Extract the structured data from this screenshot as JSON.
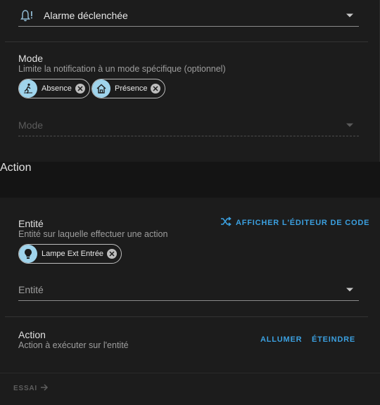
{
  "trigger": {
    "selected_value": "Alarme déclenchée"
  },
  "mode_section": {
    "label": "Mode",
    "description": "Limite la notification à un mode spécifique (optionnel)",
    "chips": [
      {
        "label": "Absence",
        "icon": "walking-person-icon"
      },
      {
        "label": "Présence",
        "icon": "home-icon"
      }
    ],
    "placeholder": "Mode"
  },
  "action_header": {
    "title": "Action"
  },
  "entity_section": {
    "label": "Entité",
    "description": "Entité sur laquelle effectuer une action",
    "code_editor_button": "AFFICHER L'ÉDITEUR DE CODE",
    "chips": [
      {
        "label": "Lampe Ext Entrée",
        "icon": "lightbulb-icon"
      }
    ],
    "placeholder": "Entité"
  },
  "action_section": {
    "label": "Action",
    "description": "Action à exécuter sur l'entité",
    "on_button": "ALLUMER",
    "off_button": "ÉTEINDRE"
  },
  "footer": {
    "test_button": "ESSAI"
  },
  "colors": {
    "accent": "#3ba0e0",
    "chip_avatar": "#9fd4ec",
    "card_bg": "#1c1c1c",
    "page_bg": "#111111"
  }
}
